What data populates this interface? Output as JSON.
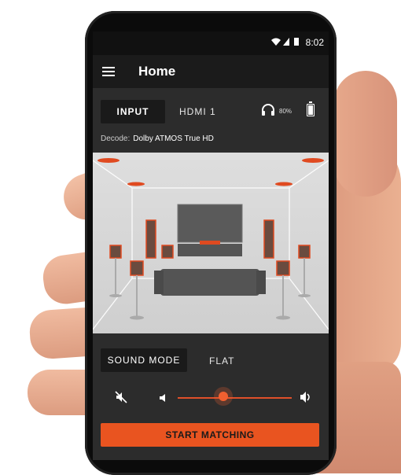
{
  "status": {
    "time": "8:02"
  },
  "appbar": {
    "title": "Home"
  },
  "input": {
    "label": "INPUT",
    "value": "HDMI 1",
    "headphone_level": "80%"
  },
  "decode": {
    "label": "Decode:",
    "value": "Dolby ATMOS True HD"
  },
  "sound": {
    "label": "SOUND MODE",
    "value": "FLAT"
  },
  "volume": {
    "level_fraction": 0.4
  },
  "cta": {
    "label": "START MATCHING"
  },
  "colors": {
    "accent": "#e95420",
    "screen_bg": "#2c2c2c",
    "appbar_bg": "#1b1b1b"
  },
  "icons": [
    "menu-icon",
    "wifi-icon",
    "signal-icon",
    "battery-icon",
    "headphones-icon",
    "mute-icon",
    "volume-down-icon",
    "volume-up-icon"
  ]
}
